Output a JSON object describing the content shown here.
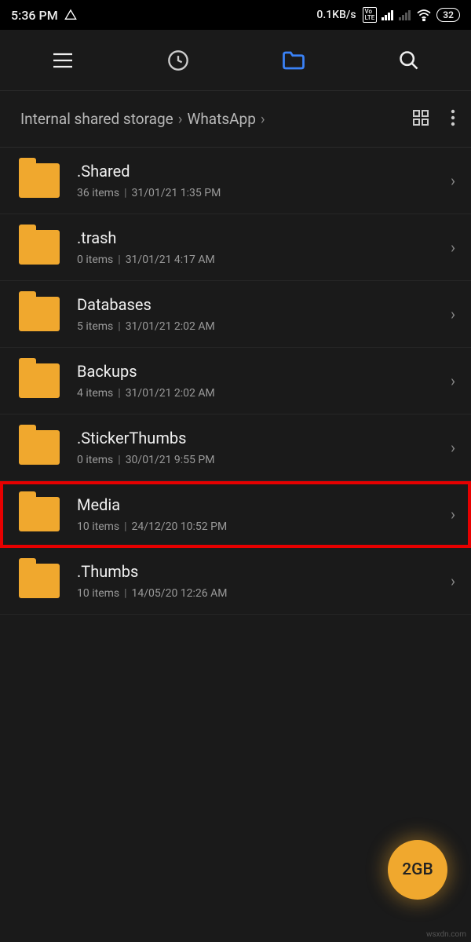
{
  "statusbar": {
    "time": "5:36 PM",
    "net_speed": "0.1KB/s",
    "battery": "32"
  },
  "toolbar": {
    "menu_icon": "menu-icon",
    "recent_icon": "clock-icon",
    "folder_icon": "folder-icon",
    "search_icon": "search-icon"
  },
  "breadcrumb": {
    "segments": [
      "Internal shared storage",
      "WhatsApp"
    ],
    "grid_icon": "grid-view-icon",
    "more_icon": "more-vert-icon"
  },
  "folders": [
    {
      "name": ".Shared",
      "items": "36 items",
      "date": "31/01/21 1:35 PM",
      "highlight": false
    },
    {
      "name": ".trash",
      "items": "0 items",
      "date": "31/01/21 4:17 AM",
      "highlight": false
    },
    {
      "name": "Databases",
      "items": "5 items",
      "date": "31/01/21 2:02 AM",
      "highlight": false
    },
    {
      "name": "Backups",
      "items": "4 items",
      "date": "31/01/21 2:02 AM",
      "highlight": false
    },
    {
      "name": ".StickerThumbs",
      "items": "0 items",
      "date": "30/01/21 9:55 PM",
      "highlight": false
    },
    {
      "name": "Media",
      "items": "10 items",
      "date": "24/12/20 10:52 PM",
      "highlight": true
    },
    {
      "name": ".Thumbs",
      "items": "10 items",
      "date": "14/05/20 12:26 AM",
      "highlight": false
    }
  ],
  "fab": {
    "label": "2GB"
  },
  "watermark": "wsxdn.com"
}
